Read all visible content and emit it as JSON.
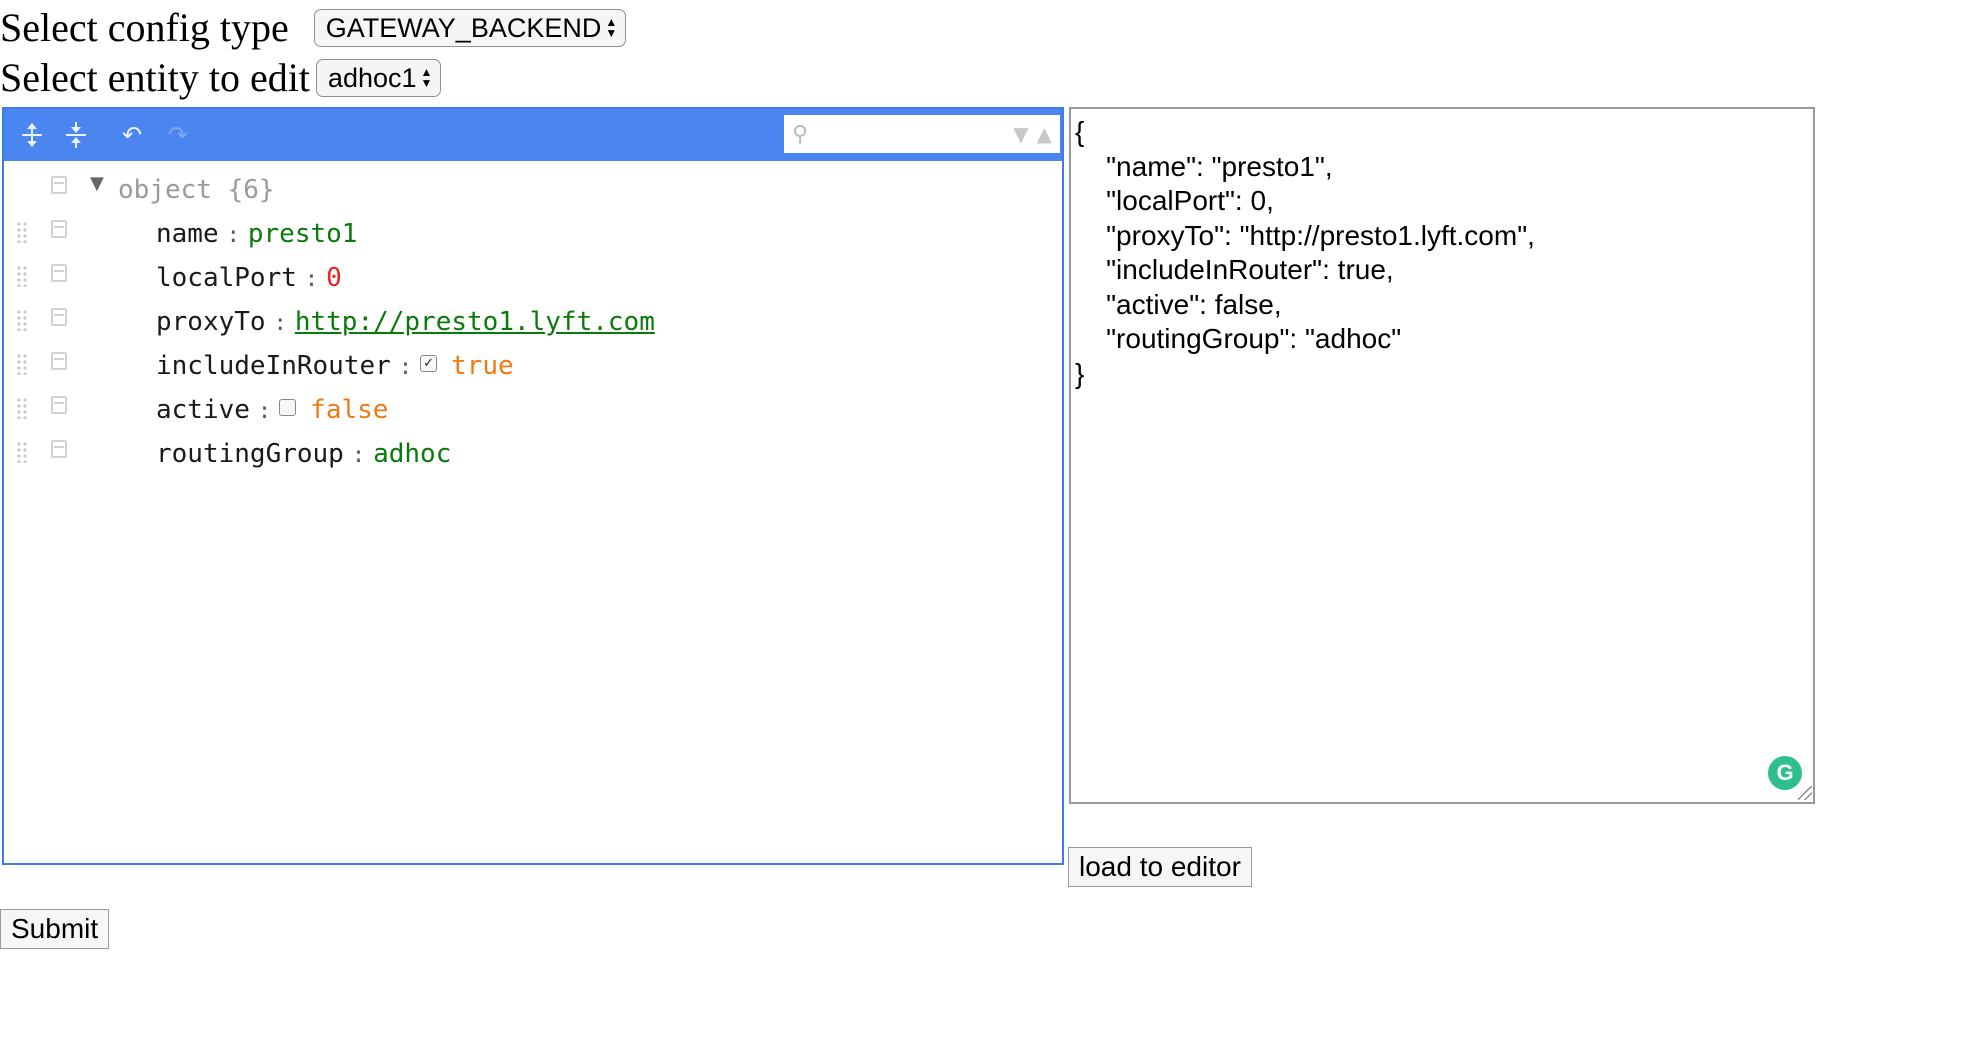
{
  "config_type": {
    "label": "Select config type",
    "selected": "GATEWAY_BACKEND"
  },
  "entity": {
    "label": "Select entity to edit",
    "selected": "adhoc1"
  },
  "tree": {
    "search_placeholder": "",
    "root_label": "object",
    "root_count": "{6}",
    "fields": [
      {
        "key": "name",
        "value": "presto1"
      },
      {
        "key": "localPort",
        "value": "0"
      },
      {
        "key": "proxyTo",
        "value": "http://presto1.lyft.com"
      },
      {
        "key": "includeInRouter",
        "value": "true"
      },
      {
        "key": "active",
        "value": "false"
      },
      {
        "key": "routingGroup",
        "value": "adhoc"
      }
    ],
    "separator": ":"
  },
  "raw_json": "{\n    \"name\": \"presto1\",\n    \"localPort\": 0,\n    \"proxyTo\": \"http://presto1.lyft.com\",\n    \"includeInRouter\": true,\n    \"active\": false,\n    \"routingGroup\": \"adhoc\"\n}",
  "buttons": {
    "load": "load to editor",
    "submit": "Submit"
  },
  "icons": {
    "expand_all": "expand-all-icon",
    "collapse_all": "collapse-all-icon",
    "undo": "undo-icon",
    "redo": "redo-icon",
    "search": "search-icon",
    "grammarly": "grammarly-icon"
  },
  "colors": {
    "menu_bar": "#4a85f0",
    "string": "#0a7a0a",
    "number": "#ee2222",
    "boolean": "#ee7a14"
  }
}
